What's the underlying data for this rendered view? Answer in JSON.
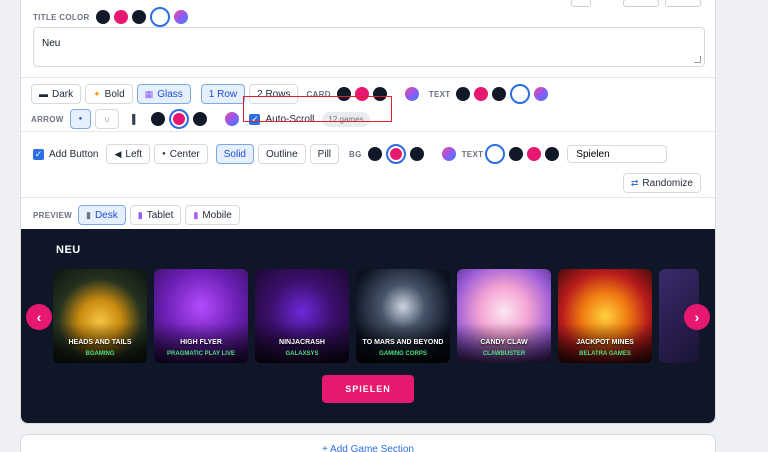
{
  "title_color": {
    "label": "TITLE COLOR"
  },
  "section_name": "Neu",
  "styles": {
    "dark": "Dark",
    "bold": "Bold",
    "glass": "Glass"
  },
  "rows": {
    "one": "1 Row",
    "two": "2 Rows"
  },
  "card_label": "CARD",
  "text_label": "TEXT",
  "arrow": {
    "label": "ARROW",
    "opt1": "●",
    "opt2": "∪",
    "opt3": "▌"
  },
  "autoscroll": {
    "label": "Auto-Scroll",
    "count": "12 games"
  },
  "add_button": {
    "label": "Add Button",
    "left": "Left",
    "center": "Center",
    "solid": "Solid",
    "outline": "Outline",
    "pill": "Pill",
    "bg_label": "BG",
    "text_label": "TEXT",
    "value": "Spielen"
  },
  "randomize": "Randomize",
  "preview": {
    "label": "PREVIEW",
    "desk": "Desk",
    "tablet": "Tablet",
    "mobile": "Mobile"
  },
  "carousel": {
    "title": "NEU",
    "prev": "‹",
    "next": "›",
    "games": [
      {
        "title": "HEADS AND TAILS",
        "provider": "BGAMING"
      },
      {
        "title": "HIGH FLYER",
        "provider": "PRAGMATIC PLAY LIVE"
      },
      {
        "title": "NINJACRASH",
        "provider": "GALAXSYS"
      },
      {
        "title": "TO MARS AND BEYOND",
        "provider": "GAMING CORPS"
      },
      {
        "title": "CANDY CLAW",
        "provider": "CLAWBUSTER"
      },
      {
        "title": "JACKPOT MINES",
        "provider": "BELATRA GAMES"
      }
    ],
    "play": "SPIELEN"
  },
  "add_section": "+ Add Game Section",
  "colors": {
    "accent": "#2b6fe0",
    "pink": "#e6186f",
    "navy": "#111827",
    "dark_bg": "#0f1628"
  }
}
